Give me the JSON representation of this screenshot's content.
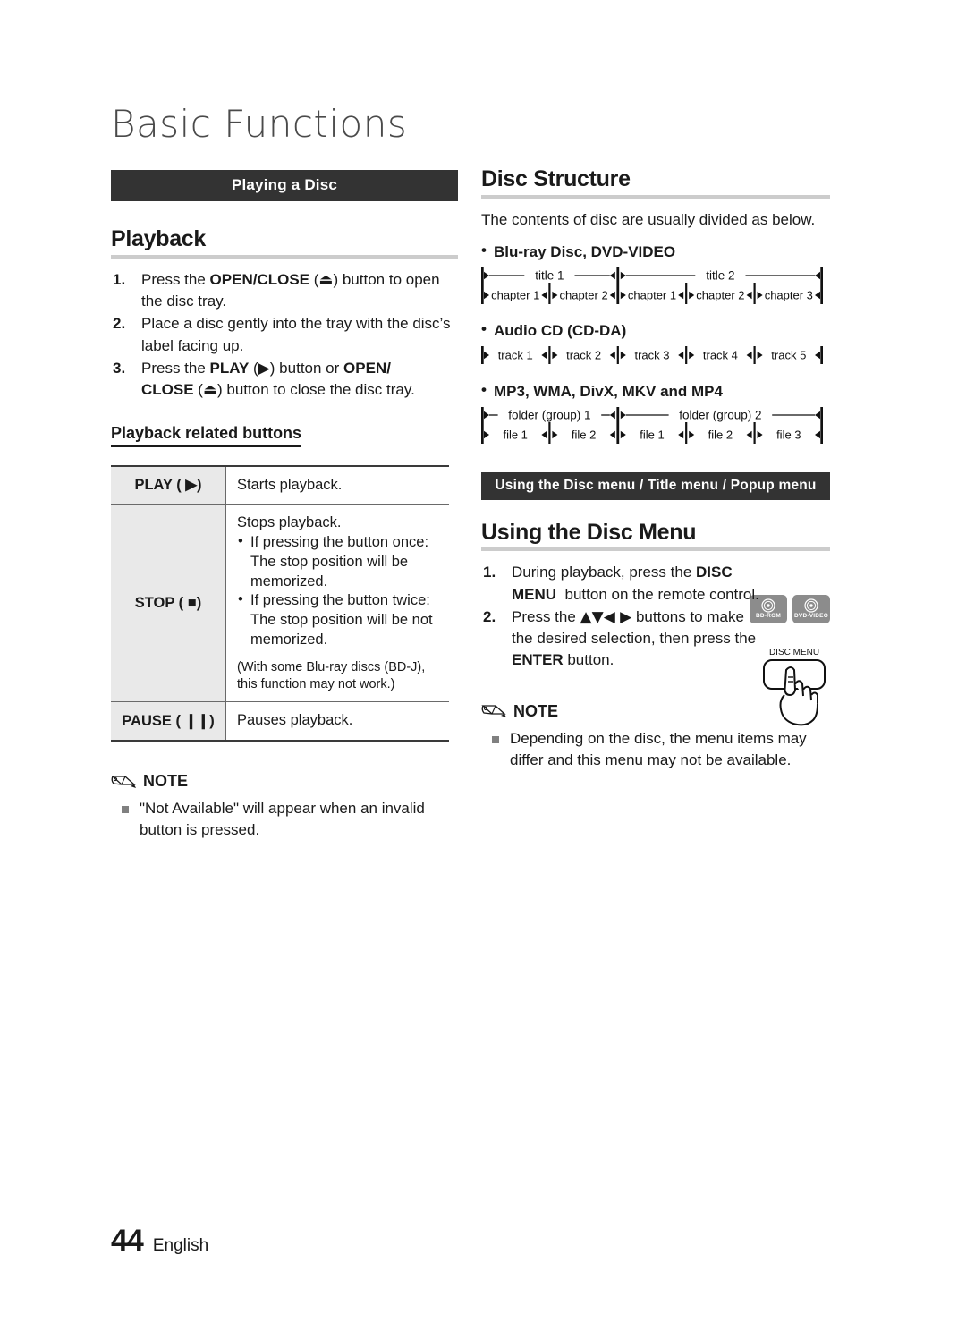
{
  "chapter_title": "Basic Functions",
  "left": {
    "banner": "Playing a Disc",
    "heading": "Playback",
    "steps": [
      {
        "num": "1.",
        "html": "Press the <b>OPEN/CLOSE</b> (<span class=\"glyph\">⏏</span>) button to open the disc tray."
      },
      {
        "num": "2.",
        "html": "Place a disc gently into the tray with the disc’s label facing up."
      },
      {
        "num": "3.",
        "html": "Press the <b>PLAY</b> (<span class=\"glyph\">▶</span>) button or <b>OPEN/<br>CLOSE</b> (<span class=\"glyph\">⏏</span>) button to close the disc tray."
      }
    ],
    "subheading": "Playback related buttons",
    "table": {
      "rows": [
        {
          "key": "PLAY ( ▶)",
          "lead": "Starts playback.",
          "bullets": [],
          "paren": ""
        },
        {
          "key": "STOP ( ■)",
          "lead": "Stops playback.",
          "bullets": [
            "If pressing the button once: The stop position will be memorized.",
            "If pressing the button twice: The stop position will be not memorized."
          ],
          "paren": "(With some Blu-ray discs (BD-J), this function may not work.)"
        },
        {
          "key": "PAUSE ( ❙❙)",
          "lead": "Pauses playback.",
          "bullets": [],
          "paren": ""
        }
      ]
    },
    "note": {
      "title": "NOTE",
      "items": [
        "\"Not Available\" will appear when an invalid button is pressed."
      ]
    }
  },
  "right": {
    "heading": "Disc Structure",
    "intro": "The contents of disc are usually divided as below.",
    "structures": [
      {
        "label": "Blu-ray Disc, DVD-VIDEO",
        "top_row": [
          "title 1",
          "title 2"
        ],
        "bottom_row": [
          "chapter 1",
          "chapter 2",
          "chapter 1",
          "chapter 2",
          "chapter 3"
        ]
      },
      {
        "label": "Audio CD (CD-DA)",
        "top_row": [],
        "bottom_row": [
          "track 1",
          "track 2",
          "track 3",
          "track 4",
          "track 5"
        ]
      },
      {
        "label": "MP3, WMA, DivX, MKV and MP4",
        "top_row": [
          "folder (group) 1",
          "folder (group) 2"
        ],
        "bottom_row": [
          "file 1",
          "file 2",
          "file 1",
          "file 2",
          "file 3"
        ]
      }
    ],
    "banner": "Using the Disc menu / Title menu / Popup menu",
    "menu_heading": "Using the Disc Menu",
    "badges": [
      {
        "label": "BD-ROM",
        "icon": "disc-icon"
      },
      {
        "label": "DVD-VIDEO",
        "icon": "disc-icon"
      }
    ],
    "remote": {
      "button_label": "DISC MENU",
      "icon": "hand-pressing-button-icon"
    },
    "steps": [
      {
        "num": "1.",
        "html": "During playback, press the <b>DISC MENU</b>&nbsp; button on the remote control."
      },
      {
        "num": "2.",
        "html": "Press the <span class=\"glyph\">▲▼◀ ▶</span> buttons to make the desired selection, then press the <b>ENTER</b> button."
      }
    ],
    "note": {
      "title": "NOTE",
      "items": [
        "Depending on the disc, the menu items may differ and this menu may not be available."
      ]
    }
  },
  "footer": {
    "page_number": "44",
    "language": "English"
  },
  "colors": {
    "banner_bg": "#333333",
    "rule_gray": "#cccccc",
    "table_key_bg": "#e9e9e9",
    "badge_bg": "#8c8c8c",
    "note_bullet": "#808080",
    "title_gray": "#4a4a4a"
  }
}
